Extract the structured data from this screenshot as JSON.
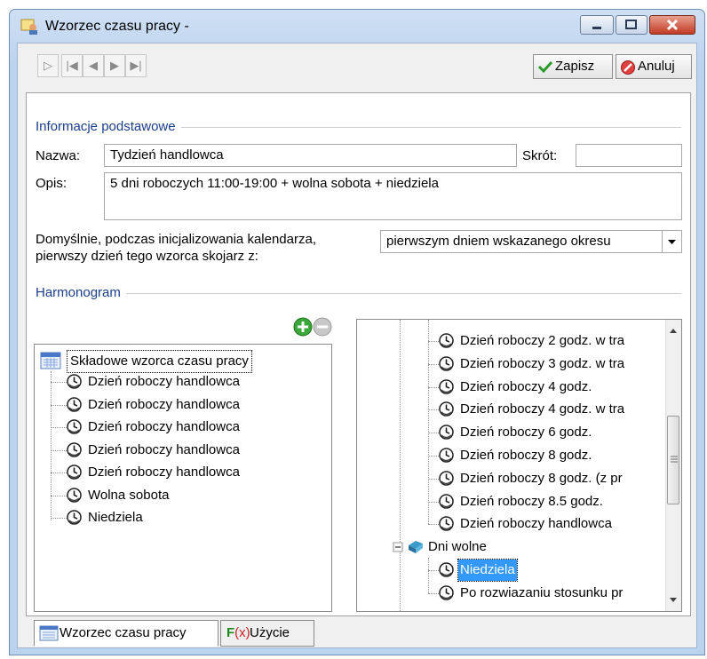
{
  "window": {
    "title": "Wzorzec czasu pracy -"
  },
  "toolbar": {
    "save_label": "Zapisz",
    "cancel_label": "Anuluj"
  },
  "basic": {
    "group_title": "Informacje podstawowe",
    "name_label": "Nazwa:",
    "name_value": "Tydzień handlowca",
    "abbr_label": "Skrót:",
    "abbr_value": "",
    "desc_label": "Opis:",
    "desc_value": "5 dni roboczych 11:00-19:00 + wolna sobota + niedziela",
    "default_label_line1": "Domyślnie, podczas inicjalizowania kalendarza,",
    "default_label_line2": "pierwszy dzień tego wzorca skojarz z:",
    "default_value": "pierwszym dniem wskazanego okresu"
  },
  "schedule": {
    "group_title": "Harmonogram",
    "root": "Składowe wzorca czasu pracy",
    "items": [
      "Dzień roboczy handlowca",
      "Dzień roboczy handlowca",
      "Dzień roboczy handlowca",
      "Dzień roboczy handlowca",
      "Dzień roboczy handlowca",
      "Wolna sobota",
      "Niedziela"
    ]
  },
  "library": {
    "work_days": [
      "Dzień roboczy 2 godz. w tra",
      "Dzień roboczy 3 godz. w tra",
      "Dzień roboczy 4 godz.",
      "Dzień roboczy 4 godz. w tra",
      "Dzień roboczy 6 godz.",
      "Dzień roboczy 8 godz.",
      "Dzień roboczy 8 godz. (z pr",
      "Dzień roboczy 8.5 godz.",
      "Dzień roboczy handlowca"
    ],
    "days_off_label": "Dni wolne",
    "days_off": [
      "Niedziela",
      "Po rozwiazaniu stosunku pr"
    ]
  },
  "tabs": {
    "pattern": "Wzorzec czasu pracy",
    "usage": "Użycie"
  },
  "colors": {
    "group_title": "#1a3e8c",
    "selected": "#3399ff"
  }
}
